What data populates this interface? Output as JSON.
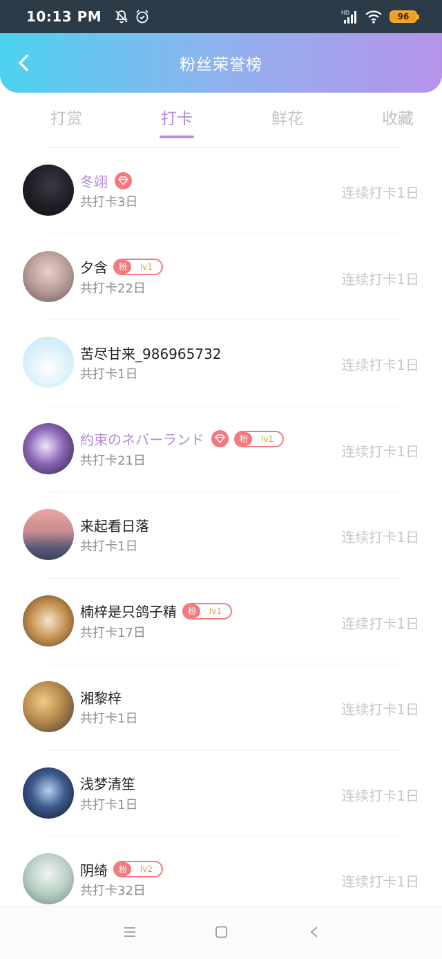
{
  "status_bar": {
    "time": "10:13 PM",
    "network": "HD",
    "battery": "96"
  },
  "header": {
    "title": "粉丝荣誉榜"
  },
  "tabs": [
    {
      "label": "打赏",
      "active": false
    },
    {
      "label": "打卡",
      "active": true
    },
    {
      "label": "鲜花",
      "active": false
    },
    {
      "label": "收藏",
      "active": false
    }
  ],
  "fans": [
    {
      "name": "冬翊",
      "total": "共打卡3日",
      "streak": "连续打卡1日",
      "vip": true,
      "badge": null
    },
    {
      "name": "夕含",
      "total": "共打卡22日",
      "streak": "连续打卡1日",
      "vip": false,
      "badge": {
        "fan": "粉",
        "level": "lv1"
      }
    },
    {
      "name": "苦尽甘来_986965732",
      "total": "共打卡1日",
      "streak": "连续打卡1日",
      "vip": false,
      "badge": null
    },
    {
      "name": "約束のネバーランド",
      "total": "共打卡21日",
      "streak": "连续打卡1日",
      "vip": true,
      "badge": {
        "fan": "粉",
        "level": "lv1"
      }
    },
    {
      "name": "来起看日落",
      "total": "共打卡1日",
      "streak": "连续打卡1日",
      "vip": false,
      "badge": null
    },
    {
      "name": "楠梓是只鸽子精",
      "total": "共打卡17日",
      "streak": "连续打卡1日",
      "vip": false,
      "badge": {
        "fan": "粉",
        "level": "lv1"
      }
    },
    {
      "name": "湘黎梓",
      "total": "共打卡1日",
      "streak": "连续打卡1日",
      "vip": false,
      "badge": null
    },
    {
      "name": "浅梦清笙",
      "total": "共打卡1日",
      "streak": "连续打卡1日",
      "vip": false,
      "badge": null
    },
    {
      "name": "阴绮",
      "total": "共打卡32日",
      "streak": "连续打卡1日",
      "vip": false,
      "badge": {
        "fan": "粉",
        "level": "lv2"
      }
    }
  ],
  "colors": {
    "accent": "#b487e0",
    "header_start": "#4cd2f0",
    "header_end": "#b693ea",
    "badge": "#f27a7e"
  }
}
